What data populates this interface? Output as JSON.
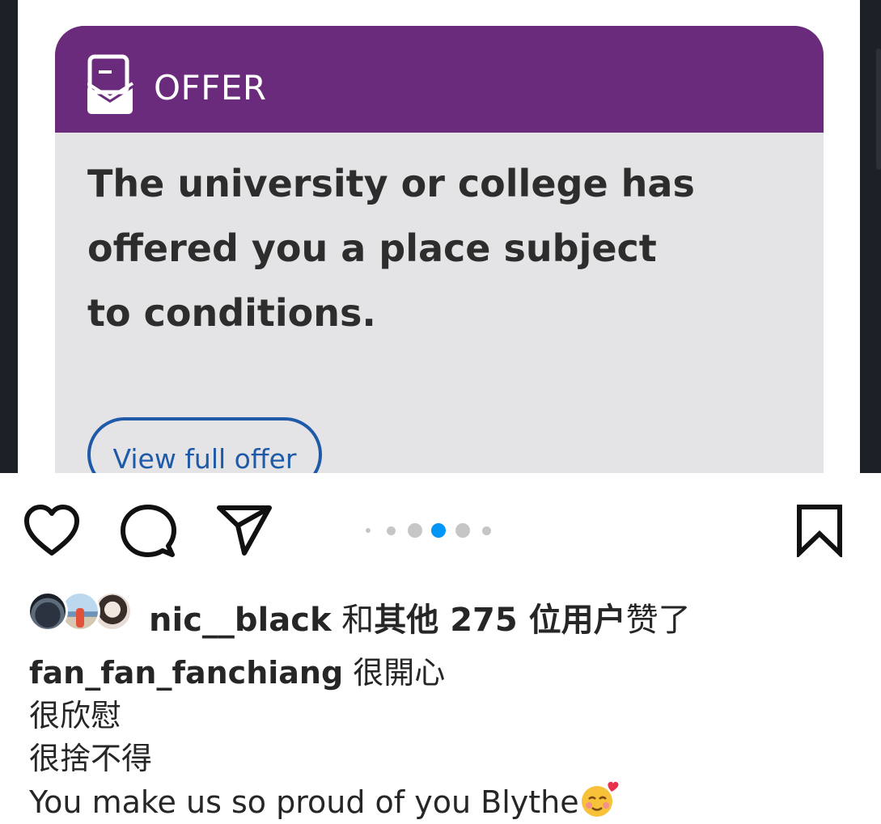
{
  "offer_card": {
    "header_title": "OFFER",
    "message": "The university or college has offered you a place subject to conditions.",
    "button_label": "View full offer",
    "header_color": "#6b2b7c",
    "button_color": "#1e5aa8"
  },
  "actions": {
    "like_icon": "heart-outline-icon",
    "comment_icon": "speech-bubble-icon",
    "share_icon": "paper-plane-icon",
    "save_icon": "bookmark-outline-icon",
    "carousel": {
      "total_dots": 6,
      "active_index": 3,
      "accent": "#0095f6"
    }
  },
  "likes": {
    "username": "nic__black",
    "joiner": "和",
    "others": "其他 275 位用户",
    "suffix": "赞了"
  },
  "caption": {
    "username": "fan_fan_fanchiang",
    "first_line": "很開心",
    "line2": "很欣慰",
    "line3": "很捨不得",
    "line4": "You make us so proud of you Blythe",
    "emoji": "smiling-face-with-hearts-icon"
  }
}
